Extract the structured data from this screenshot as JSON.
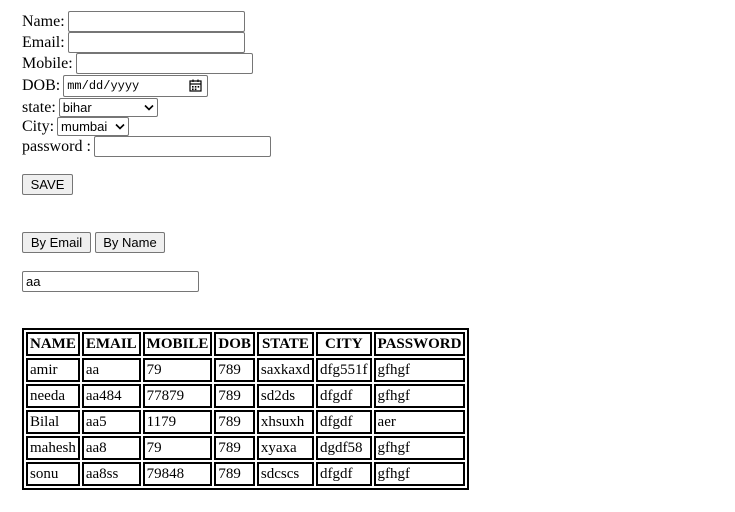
{
  "form": {
    "name_label": "Name:",
    "email_label": "Email:",
    "mobile_label": "Mobile:",
    "dob_label": "DOB:",
    "dob_placeholder": "mm/dd/yyyy",
    "state_label": "state:",
    "state_value": "bihar",
    "city_label": "City:",
    "city_value": "mumbai",
    "password_label": "password :",
    "save_label": "SAVE"
  },
  "filters": {
    "by_email_label": "By Email",
    "by_name_label": "By Name",
    "search_value": "aa"
  },
  "table": {
    "headers": [
      "NAME",
      "EMAIL",
      "MOBILE",
      "DOB",
      "STATE",
      "CITY",
      "PASSWORD"
    ],
    "rows": [
      [
        "amir",
        "aa",
        "79",
        "789",
        "saxkaxd",
        "dfg551f",
        "gfhgf"
      ],
      [
        "needa",
        "aa484",
        "77879",
        "789",
        "sd2ds",
        "dfgdf",
        "gfhgf"
      ],
      [
        "Bilal",
        "aa5",
        "1179",
        "789",
        "xhsuxh",
        "dfgdf",
        "aer"
      ],
      [
        "mahesh",
        "aa8",
        "79",
        "789",
        "xyaxa",
        "dgdf58",
        "gfhgf"
      ],
      [
        "sonu",
        "aa8ss",
        "79848",
        "789",
        "sdcscs",
        "dfgdf",
        "gfhgf"
      ]
    ]
  },
  "icons": {
    "calendar": "calendar-icon",
    "dropdown": "chevron-down-icon"
  }
}
